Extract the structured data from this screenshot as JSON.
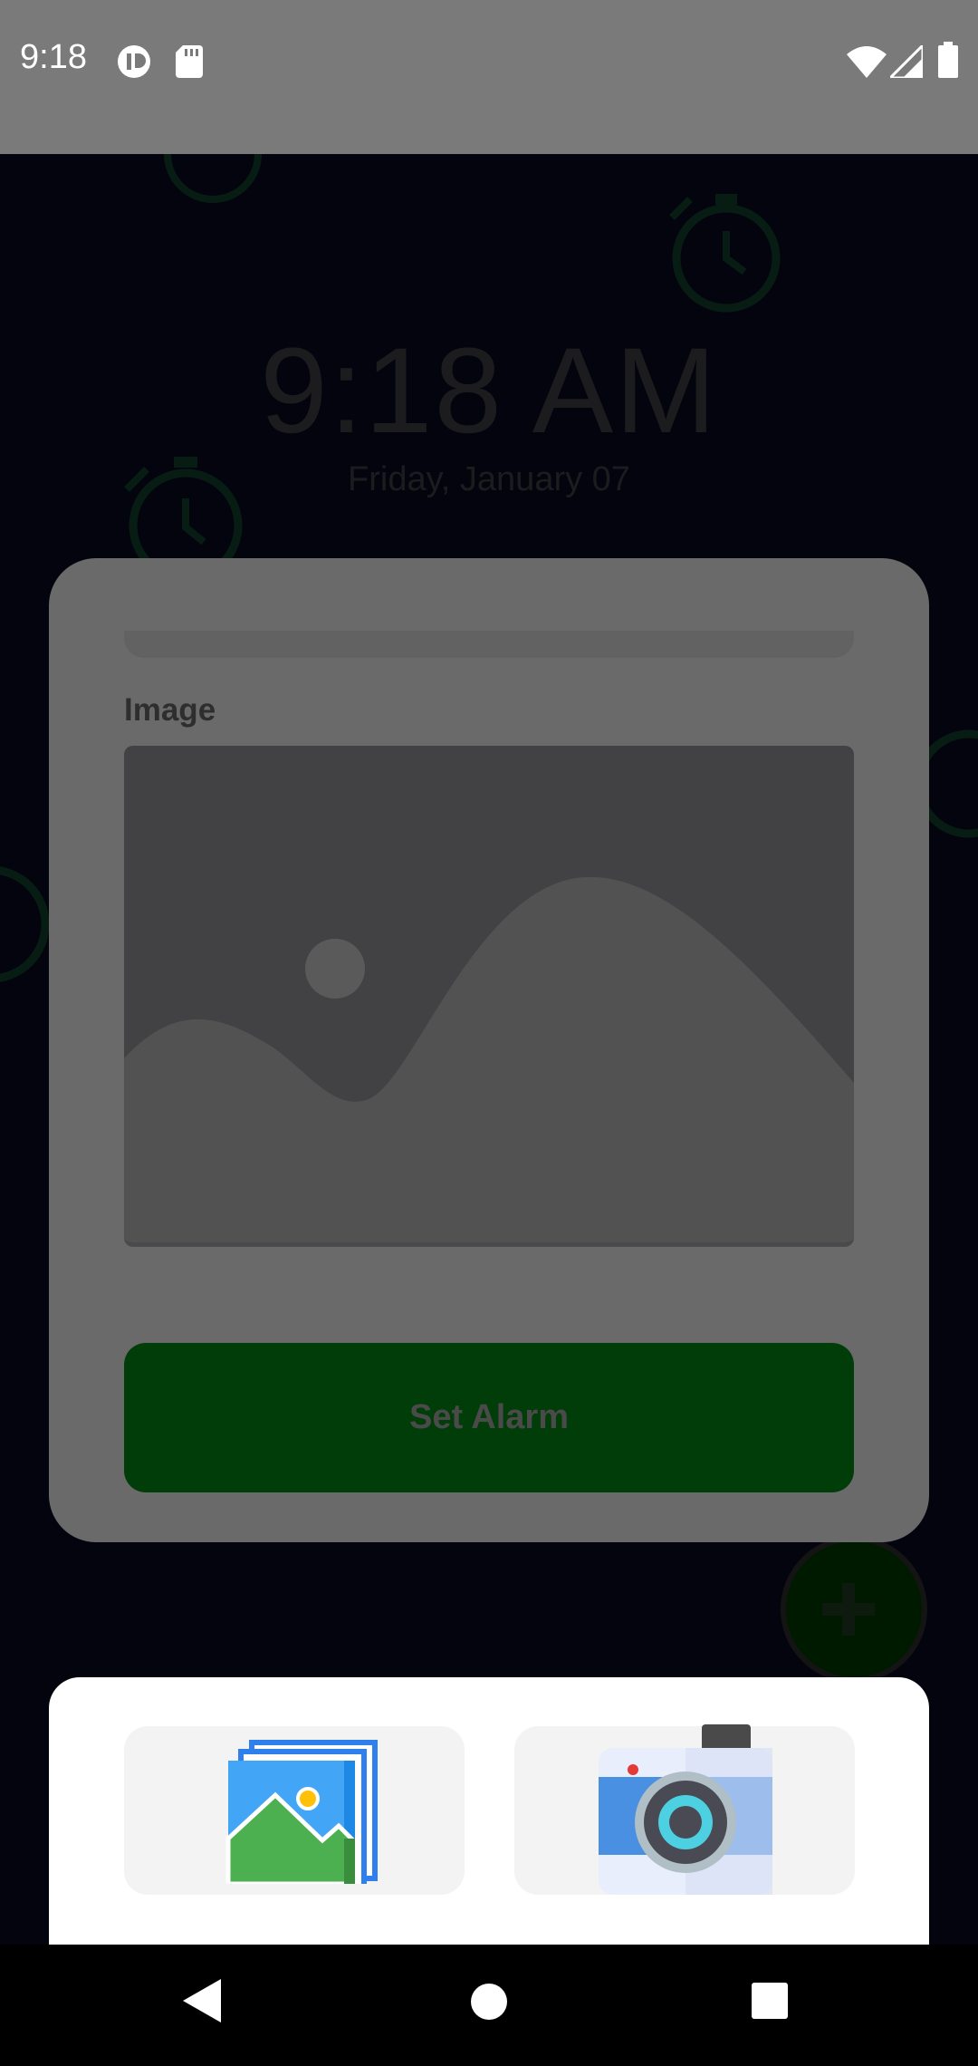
{
  "status_bar": {
    "time": "9:18",
    "left_icons": [
      "pause-circle-icon",
      "sd-card-icon"
    ],
    "right_icons": [
      "wifi-icon",
      "cell-signal-icon",
      "battery-icon"
    ]
  },
  "clock": {
    "time": "9:18 AM",
    "date": "Friday, January 07"
  },
  "dialog": {
    "image_label": "Image",
    "image_placeholder_icon": "image-placeholder-icon",
    "set_alarm_label": "Set Alarm"
  },
  "fab": {
    "icon": "plus-icon"
  },
  "picker_sheet": {
    "options": [
      {
        "icon": "gallery-icon"
      },
      {
        "icon": "camera-icon"
      }
    ]
  },
  "nav_bar": {
    "buttons": [
      "back-icon",
      "home-icon",
      "recents-icon"
    ]
  },
  "colors": {
    "accent_green": "#00c853",
    "button_green": "#003d08",
    "scrim_gray": "#6a6a6a"
  }
}
